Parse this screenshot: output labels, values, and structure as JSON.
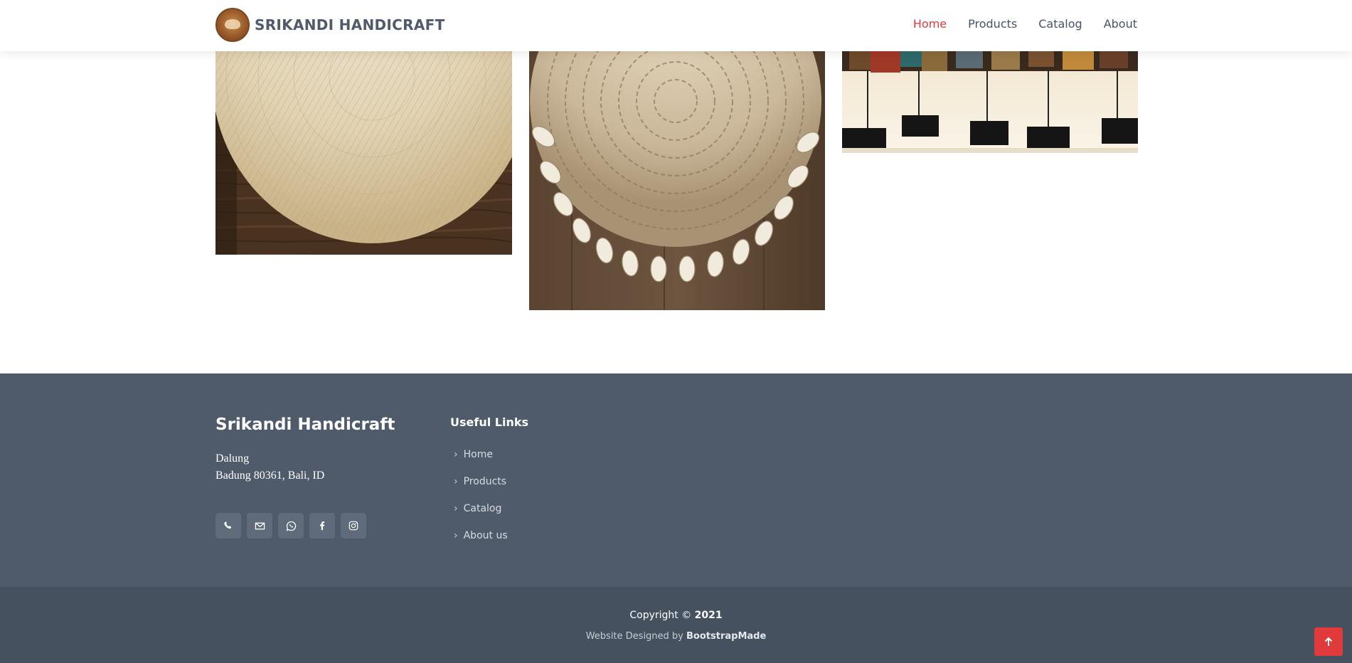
{
  "header": {
    "logo_alt": "Srikandi Handicraft logo",
    "brand": "SRIKANDI HANDICRAFT",
    "nav": [
      {
        "label": "Home",
        "active": true
      },
      {
        "label": "Products",
        "active": false
      },
      {
        "label": "Catalog",
        "active": false
      },
      {
        "label": "About",
        "active": false
      }
    ]
  },
  "gallery": [
    {
      "name": "rattan-placemat-photo"
    },
    {
      "name": "seagrass-cowrie-placemat-photo"
    },
    {
      "name": "statues-on-stands-photo"
    }
  ],
  "footer": {
    "brand": "Srikandi Handicraft",
    "address_line1": "Dalung",
    "address_line2": "Badung 80361, Bali, ID",
    "social_icons": [
      "phone-icon",
      "email-icon",
      "whatsapp-icon",
      "facebook-icon",
      "instagram-icon"
    ],
    "links_title": "Useful Links",
    "links": [
      "Home",
      "Products",
      "Catalog",
      "About us"
    ],
    "copyright_prefix": "Copyright ©",
    "copyright_year": "2021",
    "credits_prefix": "Website Designed by",
    "credits_name": "BootstrapMade"
  },
  "colors": {
    "accent": "#e03a3c",
    "footer_top": "#4f5b6a",
    "footer_bottom": "#46515f",
    "nav_text": "#47536a"
  }
}
